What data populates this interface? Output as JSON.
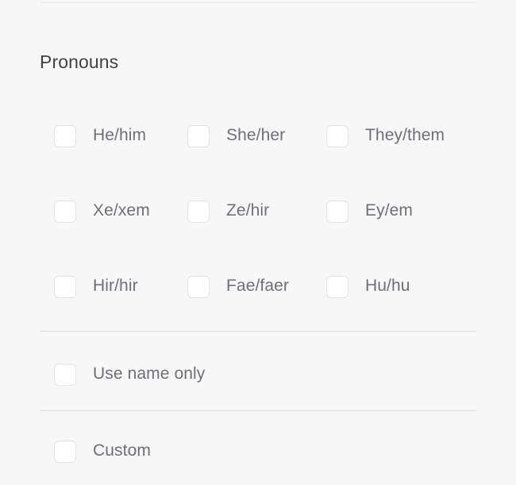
{
  "section": {
    "title": "Pronouns"
  },
  "colors": {
    "background": "#f7f7f8",
    "divider": "#e6e6e8",
    "heading_text": "#3f4146",
    "label_text": "#6e7077",
    "checkbox_fill": "#ffffff",
    "checkbox_border": "#e2e3e5"
  },
  "pronoun_grid": {
    "rows": [
      {
        "cells": [
          {
            "label": "He/him",
            "checked": false
          },
          {
            "label": "She/her",
            "checked": false
          },
          {
            "label": "They/them",
            "checked": false
          }
        ]
      },
      {
        "cells": [
          {
            "label": "Xe/xem",
            "checked": false
          },
          {
            "label": "Ze/hir",
            "checked": false
          },
          {
            "label": "Ey/em",
            "checked": false
          }
        ]
      },
      {
        "cells": [
          {
            "label": "Hir/hir",
            "checked": false
          },
          {
            "label": "Fae/faer",
            "checked": false
          },
          {
            "label": "Hu/hu",
            "checked": false
          }
        ]
      }
    ]
  },
  "extra_options": {
    "use_name_only": {
      "label": "Use name only",
      "checked": false
    },
    "custom": {
      "label": "Custom",
      "checked": false
    }
  }
}
